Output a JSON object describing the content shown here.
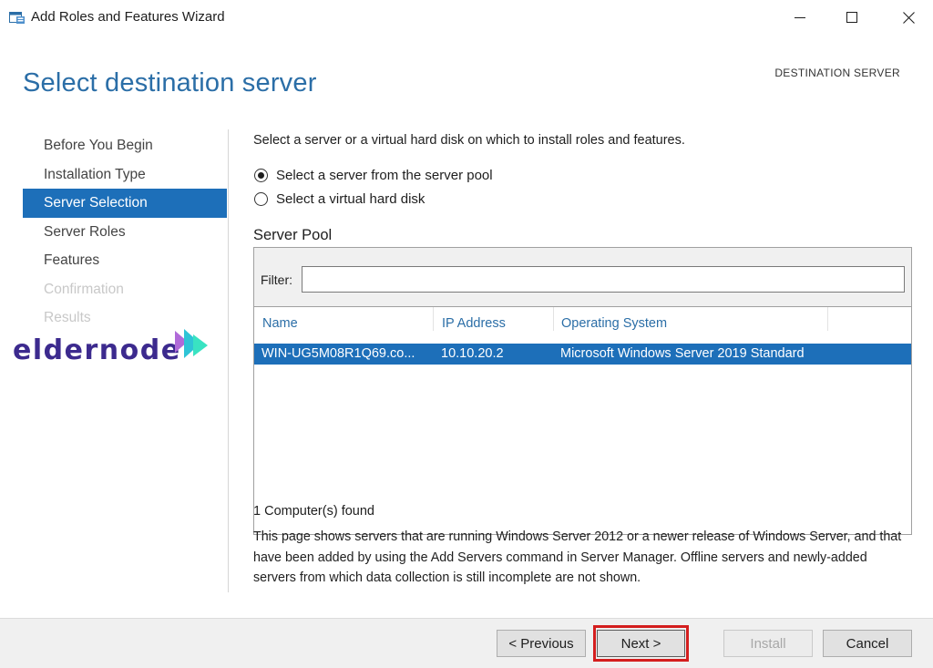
{
  "window": {
    "title": "Add Roles and Features Wizard",
    "controls": {
      "minimize": "minimize-icon",
      "maximize": "maximize-icon",
      "close": "close-icon"
    }
  },
  "header": {
    "page_title": "Select destination server",
    "destination_label": "DESTINATION SERVER"
  },
  "nav": {
    "items": [
      {
        "label": "Before You Begin",
        "state": "normal"
      },
      {
        "label": "Installation Type",
        "state": "normal"
      },
      {
        "label": "Server Selection",
        "state": "active"
      },
      {
        "label": "Server Roles",
        "state": "normal"
      },
      {
        "label": "Features",
        "state": "normal"
      },
      {
        "label": "Confirmation",
        "state": "disabled"
      },
      {
        "label": "Results",
        "state": "disabled"
      }
    ]
  },
  "logo": {
    "text": "eldernode"
  },
  "main": {
    "intro": "Select a server or a virtual hard disk on which to install roles and features.",
    "options": [
      {
        "label": "Select a server from the server pool",
        "selected": true
      },
      {
        "label": "Select a virtual hard disk",
        "selected": false
      }
    ],
    "pool": {
      "title": "Server Pool",
      "filter_label": "Filter:",
      "filter_value": "",
      "columns": [
        "Name",
        "IP Address",
        "Operating System"
      ],
      "rows": [
        {
          "name": "WIN-UG5M08R1Q69.co...",
          "ip": "10.10.20.2",
          "os": "Microsoft Windows Server 2019 Standard",
          "selected": true
        }
      ]
    },
    "found": "1 Computer(s) found",
    "note": "This page shows servers that are running Windows Server 2012 or a newer release of Windows Server, and that have been added by using the Add Servers command in Server Manager. Offline servers and newly-added servers from which data collection is still incomplete are not shown."
  },
  "footer": {
    "previous": "< Previous",
    "next": "Next >",
    "install": "Install",
    "cancel": "Cancel"
  },
  "colors": {
    "accent": "#1d6fb9",
    "title": "#2b6ea7",
    "highlight": "#d41e1e",
    "logo": "#3c2a8e"
  }
}
